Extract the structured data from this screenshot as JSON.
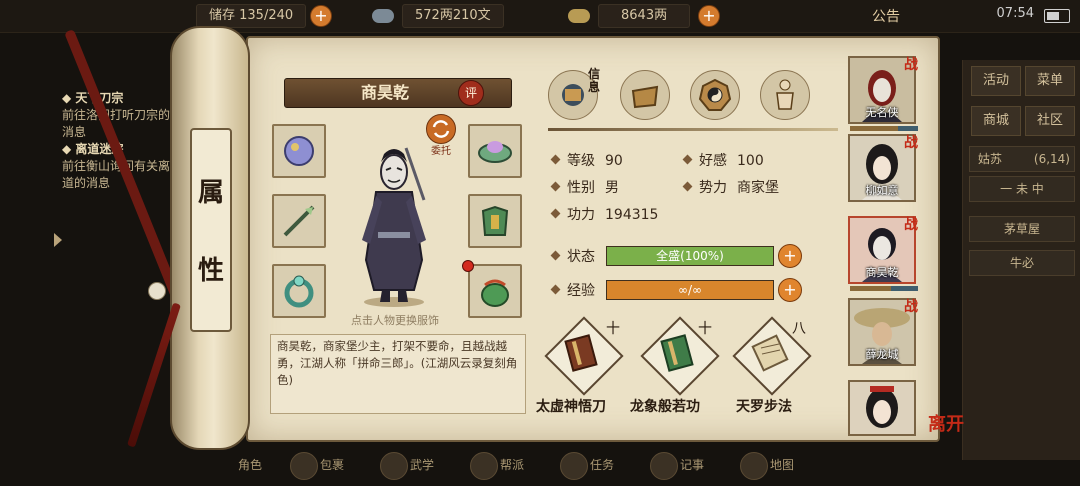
{
  "topbar": {
    "storage": "储存 135/240",
    "copper": "572两210文",
    "silver": "8643两",
    "notice": "公告",
    "clock": "07:54"
  },
  "questlog": [
    {
      "title": "天下刀宗",
      "desc": "前往洛阳打听刀宗的消息"
    },
    {
      "title": "离道迷踪",
      "desc": "前往衡山询问有关离道的消息"
    }
  ],
  "sidemenu": {
    "buttons": [
      "活动",
      "菜单",
      "商城",
      "社区"
    ],
    "location": "姑苏",
    "coords": "(6,14)",
    "extra": "一 未 中",
    "places": [
      "茅草屋",
      "牛必"
    ]
  },
  "scroll": {
    "chars": [
      "属",
      "性"
    ]
  },
  "character": {
    "name": "商昊乾",
    "review": "评",
    "swap_label": "委托",
    "hint": "点击人物更换服饰",
    "description": "商昊乾，商家堡少主，打架不要命，且越战越勇，江湖人称「拼命三郎」。(江湖风云录复刻角色)"
  },
  "equipment": [
    {
      "name": "gauntlet"
    },
    {
      "name": "hat"
    },
    {
      "name": "spear-weapon"
    },
    {
      "name": "armor"
    },
    {
      "name": "ring"
    },
    {
      "name": "pouch"
    }
  ],
  "tabs": [
    {
      "name": "info",
      "label": "信息"
    },
    {
      "name": "bag"
    },
    {
      "name": "bagua"
    },
    {
      "name": "meridian"
    }
  ],
  "stats": {
    "level": {
      "label": "等级",
      "value": "90"
    },
    "affinity": {
      "label": "好感",
      "value": "100"
    },
    "gender": {
      "label": "性别",
      "value": "男"
    },
    "faction": {
      "label": "势力",
      "value": "商家堡"
    },
    "power": {
      "label": "功力",
      "value": "194315"
    }
  },
  "bars": {
    "status": {
      "label": "状态",
      "text": "全盛(100%)",
      "fill": 1.0,
      "color": "#7bb04a"
    },
    "exp": {
      "label": "经验",
      "text": "∞/∞",
      "fill": 1.0,
      "color": "#d8862c"
    }
  },
  "skills": [
    {
      "name": "太虚神悟刀",
      "level": "十"
    },
    {
      "name": "龙象般若功",
      "level": "十"
    },
    {
      "name": "天罗步法",
      "level": "八"
    }
  ],
  "party": [
    {
      "name": "无名侠",
      "tag": "战"
    },
    {
      "name": "柳如意",
      "tag": "战"
    },
    {
      "name": "商昊乾",
      "tag": "战"
    },
    {
      "name": "薛龙城",
      "tag": "战"
    },
    {
      "name": "",
      "tag": ""
    }
  ],
  "leave": "离开",
  "bottom_nav": [
    "角色",
    "包裹",
    "武学",
    "帮派",
    "任务",
    "记事",
    "地图"
  ]
}
